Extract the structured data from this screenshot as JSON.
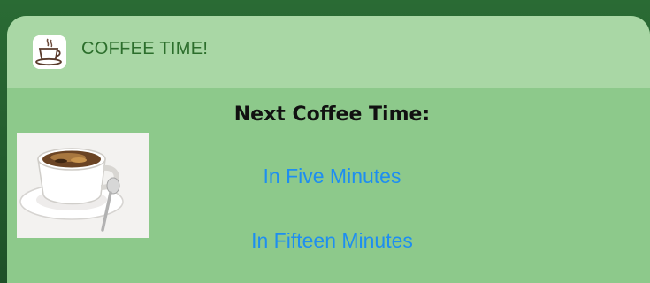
{
  "widget": {
    "app_title": "COFFEE TIME!",
    "heading": "Next Coffee Time:",
    "actions": [
      {
        "label": "In Five Minutes"
      },
      {
        "label": "In Fifteen Minutes"
      }
    ]
  },
  "icons": {
    "app_icon": "coffee-cup-icon",
    "thumbnail": "coffee-cup-image"
  },
  "colors": {
    "header_bg": "#a9d7a5",
    "body_bg": "#8dc98b",
    "title_green": "#2c6e2c",
    "link_blue": "#1e8ef0"
  }
}
